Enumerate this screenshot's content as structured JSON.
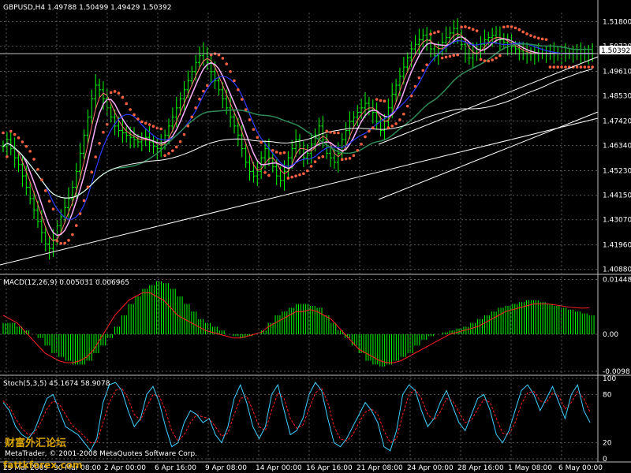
{
  "chart_data": {
    "type": "line",
    "title": "GBPUSD,H4  1.49788 1.50499 1.49429 1.50392",
    "last_price": "1.50392",
    "price_axis": {
      "ylim": [
        1.408,
        1.522
      ],
      "ticks": [
        "1.51800",
        "1.50720",
        "1.49610",
        "1.48530",
        "1.47420",
        "1.46340",
        "1.45230",
        "1.44150",
        "1.43070",
        "1.41960",
        "1.40880"
      ]
    },
    "x_axis": {
      "ticks": [
        "25 Mar 2009",
        "30 Mar 08:00",
        "2 Apr 00:00",
        "6 Apr 16:00",
        "9 Apr 08:00",
        "14 Apr 00:00",
        "16 Apr 16:00",
        "21 Apr 08:00",
        "24 Apr 00:00",
        "28 Apr 16:00",
        "1 May 08:00",
        "6 May 00:00"
      ]
    },
    "price_series": {
      "x": [
        0,
        1,
        2,
        3,
        4,
        5,
        6,
        7,
        8,
        9,
        10,
        11,
        12,
        13,
        14,
        15,
        16,
        17,
        18,
        19,
        20,
        21,
        22,
        23,
        24,
        25,
        26,
        27,
        28,
        29,
        30,
        31,
        32,
        33,
        34,
        35,
        36,
        37,
        38,
        39,
        40,
        41,
        42,
        43,
        44,
        45,
        46,
        47,
        48,
        49,
        50,
        51,
        52,
        53,
        54,
        55,
        56,
        57,
        58,
        59,
        60,
        61,
        62,
        63,
        64,
        65,
        66,
        67,
        68,
        69,
        70,
        71,
        72,
        73,
        74,
        75,
        76,
        77,
        78,
        79,
        80,
        81,
        82,
        83,
        84,
        85,
        86,
        87,
        88,
        89,
        90,
        91,
        92,
        93,
        94,
        95,
        96,
        97,
        98,
        99,
        100,
        101,
        102,
        103,
        104,
        105,
        106,
        107,
        108,
        109,
        110,
        111,
        112,
        113,
        114,
        115,
        116,
        117,
        118,
        119,
        120,
        121,
        122,
        123,
        124,
        125,
        126,
        127,
        128,
        129,
        130,
        131,
        132,
        133,
        134,
        135,
        136,
        137,
        138,
        139,
        140,
        141,
        142,
        143,
        144,
        145,
        146,
        147,
        148,
        149
      ],
      "close": [
        1.463,
        1.466,
        1.462,
        1.458,
        1.455,
        1.45,
        1.445,
        1.44,
        1.435,
        1.43,
        1.425,
        1.42,
        1.418,
        1.422,
        1.428,
        1.432,
        1.436,
        1.44,
        1.445,
        1.452,
        1.46,
        1.468,
        1.476,
        1.484,
        1.49,
        1.488,
        1.484,
        1.48,
        1.476,
        1.472,
        1.47,
        1.469,
        1.468,
        1.467,
        1.466,
        1.465,
        1.466,
        1.467,
        1.465,
        1.463,
        1.462,
        1.464,
        1.468,
        1.472,
        1.476,
        1.48,
        1.484,
        1.488,
        1.492,
        1.496,
        1.5,
        1.503,
        1.504,
        1.5,
        1.496,
        1.492,
        1.488,
        1.484,
        1.48,
        1.476,
        1.472,
        1.468,
        1.462,
        1.456,
        1.452,
        1.45,
        1.452,
        1.458,
        1.462,
        1.458,
        1.454,
        1.45,
        1.448,
        1.452,
        1.458,
        1.462,
        1.466,
        1.462,
        1.458,
        1.46,
        1.464,
        1.468,
        1.472,
        1.466,
        1.46,
        1.458,
        1.456,
        1.46,
        1.466,
        1.47,
        1.474,
        1.476,
        1.478,
        1.48,
        1.482,
        1.48,
        1.478,
        1.474,
        1.47,
        1.474,
        1.48,
        1.486,
        1.49,
        1.494,
        1.498,
        1.502,
        1.506,
        1.508,
        1.51,
        1.512,
        1.51,
        1.506,
        1.503,
        1.506,
        1.509,
        1.511,
        1.513,
        1.515,
        1.512,
        1.508,
        1.504,
        1.502,
        1.504,
        1.506,
        1.508,
        1.51,
        1.511,
        1.512,
        1.511,
        1.51,
        1.509,
        1.508,
        1.507,
        1.506,
        1.505,
        1.504,
        1.504,
        1.504,
        1.504,
        1.504,
        1.504,
        1.504,
        1.504,
        1.504,
        1.504,
        1.504,
        1.504,
        1.504,
        1.504,
        1.504,
        1.504,
        1.504,
        1.504,
        1.504
      ]
    },
    "macd": {
      "label": "MACD(12,26,9) 0.005031 0.006965",
      "ylim": [
        -0.01,
        0.015
      ],
      "ticks": [
        "0.014486",
        "0.00",
        "-0.0098"
      ],
      "histogram": [
        0.003,
        0.003,
        0.002,
        0.001,
        0.0,
        -0.001,
        -0.003,
        -0.005,
        -0.006,
        -0.007,
        -0.008,
        -0.008,
        -0.007,
        -0.005,
        -0.003,
        -0.001,
        0.002,
        0.005,
        0.008,
        0.01,
        0.012,
        0.013,
        0.014,
        0.0135,
        0.012,
        0.01,
        0.008,
        0.006,
        0.004,
        0.003,
        0.002,
        0.001,
        0.0,
        -0.0005,
        -0.001,
        -0.0005,
        0.0,
        0.001,
        0.003,
        0.005,
        0.006,
        0.007,
        0.008,
        0.008,
        0.0075,
        0.007,
        0.005,
        0.003,
        0.001,
        -0.001,
        -0.003,
        -0.005,
        -0.007,
        -0.008,
        -0.0085,
        -0.008,
        -0.007,
        -0.006,
        -0.005,
        -0.003,
        -0.0015,
        -0.0005,
        0.0,
        0.0005,
        0.001,
        0.0015,
        0.002,
        0.003,
        0.004,
        0.005,
        0.006,
        0.007,
        0.0075,
        0.008,
        0.0085,
        0.009,
        0.009,
        0.0085,
        0.008,
        0.0075,
        0.007,
        0.0065,
        0.006,
        0.0055,
        0.005
      ],
      "signal": [
        0.005,
        0.004,
        0.003,
        0.001,
        -0.001,
        -0.003,
        -0.005,
        -0.006,
        -0.007,
        -0.0075,
        -0.0075,
        -0.007,
        -0.006,
        -0.004,
        -0.001,
        0.002,
        0.005,
        0.007,
        0.009,
        0.01,
        0.011,
        0.011,
        0.01,
        0.009,
        0.007,
        0.005,
        0.004,
        0.003,
        0.002,
        0.001,
        0.0005,
        0.0,
        -0.0005,
        -0.001,
        -0.001,
        -0.0005,
        0.0,
        0.0005,
        0.002,
        0.003,
        0.004,
        0.005,
        0.006,
        0.006,
        0.0065,
        0.006,
        0.005,
        0.004,
        0.002,
        0.0,
        -0.002,
        -0.004,
        -0.005,
        -0.006,
        -0.007,
        -0.0075,
        -0.0075,
        -0.007,
        -0.006,
        -0.005,
        -0.004,
        -0.003,
        -0.002,
        -0.001,
        0.0,
        0.0005,
        0.001,
        0.0015,
        0.002,
        0.003,
        0.004,
        0.005,
        0.006,
        0.0065,
        0.007,
        0.0075,
        0.008,
        0.008,
        0.008,
        0.0078,
        0.0075,
        0.0072,
        0.007,
        0.0069,
        0.00697
      ]
    },
    "stoch": {
      "label": "Stoch(5,3,5) 45.1674 58.9078",
      "ylim": [
        0,
        100
      ],
      "ticks": [
        "100",
        "80",
        "20",
        "0"
      ],
      "main": [
        70,
        60,
        40,
        30,
        25,
        35,
        55,
        75,
        80,
        60,
        40,
        35,
        30,
        20,
        10,
        25,
        70,
        92,
        95,
        85,
        60,
        40,
        50,
        80,
        90,
        70,
        40,
        15,
        20,
        45,
        60,
        55,
        45,
        50,
        30,
        20,
        40,
        75,
        92,
        70,
        40,
        25,
        40,
        80,
        92,
        60,
        30,
        35,
        50,
        80,
        95,
        85,
        50,
        20,
        15,
        25,
        40,
        55,
        70,
        60,
        45,
        15,
        10,
        35,
        80,
        92,
        85,
        60,
        40,
        50,
        70,
        85,
        65,
        45,
        35,
        55,
        75,
        80,
        60,
        30,
        20,
        35,
        60,
        85,
        92,
        80,
        60,
        75,
        90,
        70,
        50,
        80,
        92,
        60,
        45
      ],
      "signal": [
        72,
        65,
        50,
        38,
        30,
        32,
        45,
        62,
        72,
        68,
        55,
        42,
        35,
        28,
        20,
        20,
        45,
        70,
        85,
        88,
        75,
        55,
        48,
        65,
        80,
        78,
        60,
        35,
        22,
        30,
        45,
        55,
        52,
        50,
        40,
        28,
        32,
        55,
        75,
        78,
        60,
        40,
        35,
        60,
        82,
        75,
        50,
        38,
        42,
        62,
        82,
        88,
        70,
        40,
        25,
        22,
        30,
        45,
        58,
        62,
        55,
        35,
        20,
        25,
        55,
        80,
        86,
        75,
        55,
        48,
        58,
        75,
        72,
        58,
        45,
        48,
        62,
        74,
        70,
        50,
        32,
        30,
        45,
        68,
        82,
        84,
        72,
        70,
        82,
        78,
        62,
        70,
        84,
        75,
        58
      ]
    }
  },
  "footer": {
    "copyright": "MetaTrader, © 2001-2008 MetaQuotes Software Corp.",
    "watermark_text": "财富外汇论坛",
    "watermark_url": "fattkforex.com"
  }
}
